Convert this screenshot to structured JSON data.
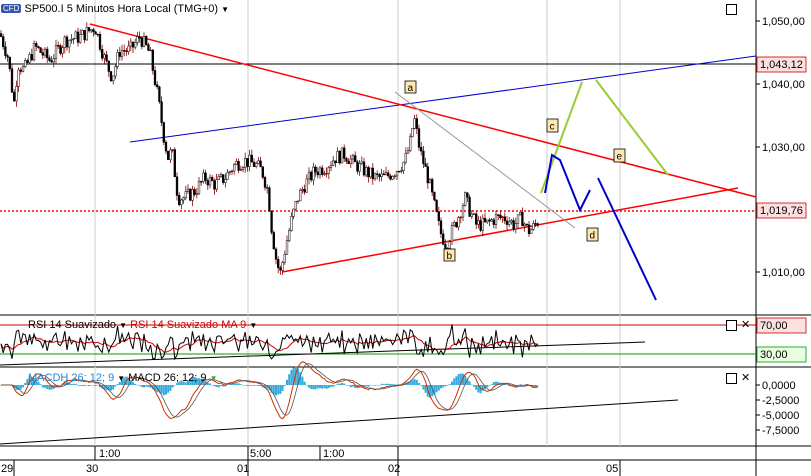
{
  "header": {
    "logo_text": "CFD",
    "title": "SP500.I 5 Minutos Hora Local (TMG+0)",
    "dropdown_icon": "caret-down-icon"
  },
  "colors": {
    "candle_up": "#ffffff",
    "candle_down": "#000000",
    "shadow": "#8b0000",
    "red_line": "#ff0000",
    "blue_line": "#0000cc",
    "green_line": "#99cc33",
    "gray_line": "#999999",
    "price_box_bg": "#ffe0e0",
    "label_box_bg": "#ffe8b0",
    "macd_hist": "#33aadd",
    "rsi_line": "#000000",
    "rsi_ma": "#cc0000",
    "level70": "#cc0000",
    "level30": "#009900"
  },
  "chart_data": [
    {
      "type": "candlestick",
      "title": "SP500.I 5 Minutos Hora Local (TMG+0)",
      "y_ticks": [
        "1,050,00",
        "1,040,00",
        "1,030,00",
        "1,020,00",
        "1,010,00"
      ],
      "ylim": [
        1005.5,
        1052.5
      ],
      "price_labels": [
        "1,043,12",
        "1,019,76"
      ],
      "price_levels": [
        1043.12,
        1019.76
      ],
      "wave_labels": [
        "a",
        "b",
        "c",
        "d",
        "e"
      ],
      "close_path": [
        [
          0,
          1047.5
        ],
        [
          8,
          1044
        ],
        [
          14,
          1037
        ],
        [
          18,
          1043
        ],
        [
          24,
          1042
        ],
        [
          35,
          1045.5
        ],
        [
          50,
          1043.5
        ],
        [
          65,
          1046.5
        ],
        [
          80,
          1047
        ],
        [
          95,
          1048.5
        ],
        [
          105,
          1043.5
        ],
        [
          112,
          1041
        ],
        [
          120,
          1045
        ],
        [
          130,
          1045
        ],
        [
          140,
          1047
        ],
        [
          150,
          1044.5
        ],
        [
          158,
          1038
        ],
        [
          164,
          1032
        ],
        [
          168,
          1029
        ],
        [
          172,
          1030
        ],
        [
          178,
          1023
        ],
        [
          185,
          1023
        ],
        [
          195,
          1024
        ],
        [
          205,
          1026
        ],
        [
          215,
          1025
        ],
        [
          225,
          1026
        ],
        [
          235,
          1028
        ],
        [
          245,
          1028.5
        ],
        [
          255,
          1028
        ],
        [
          262,
          1027
        ],
        [
          268,
          1024
        ],
        [
          272,
          1018
        ],
        [
          276,
          1014
        ],
        [
          280,
          1011.5
        ],
        [
          286,
          1016
        ],
        [
          292,
          1020
        ],
        [
          298,
          1023
        ],
        [
          305,
          1025
        ],
        [
          315,
          1027
        ],
        [
          325,
          1027.5
        ],
        [
          335,
          1029
        ],
        [
          345,
          1029.5
        ],
        [
          355,
          1028
        ],
        [
          365,
          1027
        ],
        [
          375,
          1026
        ],
        [
          385,
          1026
        ],
        [
          395,
          1027
        ],
        [
          405,
          1028.5
        ],
        [
          410,
          1031
        ],
        [
          414,
          1035
        ],
        [
          420,
          1030
        ],
        [
          428,
          1026
        ],
        [
          434,
          1022
        ],
        [
          440,
          1018
        ],
        [
          446,
          1016
        ],
        [
          452,
          1018
        ],
        [
          458,
          1020
        ],
        [
          465,
          1023
        ],
        [
          470,
          1021
        ],
        [
          476,
          1019
        ],
        [
          486,
          1019
        ],
        [
          496,
          1020
        ],
        [
          506,
          1020
        ],
        [
          514,
          1019
        ],
        [
          522,
          1020
        ],
        [
          528,
          1018
        ],
        [
          533,
          1018.5
        ],
        [
          538,
          1019.5
        ]
      ]
    },
    {
      "type": "line",
      "title": "RSI 14 Suavizado",
      "series": [
        {
          "name": "RSI 14 Suavizado",
          "values": []
        },
        {
          "name": "RSI 14 Suavizado MA 9",
          "values": []
        }
      ],
      "levels": [
        "70,00",
        "30,00"
      ]
    },
    {
      "type": "line",
      "title": "MACDH 26; 12; 9",
      "series": [
        {
          "name": "MACDH 26; 12; 9",
          "values": []
        },
        {
          "name": "MACD 26; 12; 9",
          "values": []
        }
      ],
      "y_ticks": [
        "0,0000",
        "-2,5000",
        "-5,0000",
        "-7,5000"
      ]
    }
  ],
  "x_axis": {
    "ticks": [
      "29",
      "1:00",
      "30",
      "5:00",
      "01",
      "1:00",
      "02",
      "05"
    ]
  },
  "rsi_panel": {
    "title": "RSI 14 Suavizado",
    "ma_title": "RSI 14 Suavizado MA 9",
    "level70": "70,00",
    "level30": "30,00"
  },
  "macd_panel": {
    "title": "MACDH 26; 12; 9",
    "macd_title": "MACD 26; 12; 9"
  }
}
